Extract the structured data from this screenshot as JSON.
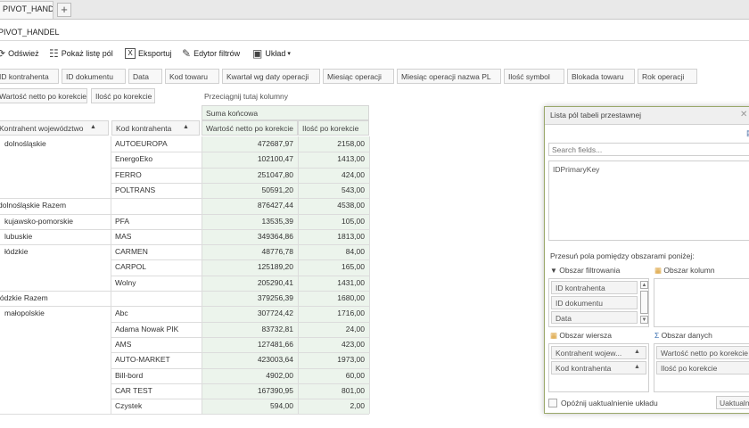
{
  "tab": {
    "label": "PIVOT_HANDEL",
    "add": "+"
  },
  "document_title": "PIVOT_HANDEL",
  "toolbar": {
    "refresh": "Odśwież",
    "show_field_list": "Pokaż listę pól",
    "export": "Eksportuj",
    "filter_editor": "Edytor filtrów",
    "layout": "Układ"
  },
  "filter_fields": [
    "ID kontrahenta",
    "ID dokumentu",
    "Data",
    "Kod towaru",
    "Kwartał wg daty operacji",
    "Miesiąc operacji",
    "Miesiąc operacji nazwa PL",
    "Ilość symbol",
    "Blokada towaru",
    "Rok operacji"
  ],
  "data_fields": [
    "Wartość netto po korekcie",
    "Ilość po korekcie"
  ],
  "column_drop_hint": "Przeciągnij tutaj kolumny",
  "grand_total_label": "Suma końcowa",
  "row_headers": {
    "voivodeship": "Kontrahent województwo",
    "code": "Kod kontrahenta"
  },
  "value_headers": {
    "net": "Wartość netto po korekcie",
    "qty": "Ilość po korekcie"
  },
  "rows": [
    {
      "group": "dolnośląskie",
      "code": "AUTOEUROPA",
      "net": "472687,97",
      "qty": "2158,00"
    },
    {
      "group": "",
      "code": "EnergoEko",
      "net": "102100,47",
      "qty": "1413,00"
    },
    {
      "group": "",
      "code": "FERRO",
      "net": "251047,80",
      "qty": "424,00"
    },
    {
      "group": "",
      "code": "POLTRANS",
      "net": "50591,20",
      "qty": "543,00"
    },
    {
      "group": "dolnośląskie Razem",
      "code": "",
      "net": "876427,44",
      "qty": "4538,00",
      "total": true
    },
    {
      "group": "kujawsko-pomorskie",
      "code": "PFA",
      "net": "13535,39",
      "qty": "105,00"
    },
    {
      "group": "lubuskie",
      "code": "MAS",
      "net": "349364,86",
      "qty": "1813,00"
    },
    {
      "group": "łódzkie",
      "code": "CARMEN",
      "net": "48776,78",
      "qty": "84,00"
    },
    {
      "group": "",
      "code": "CARPOL",
      "net": "125189,20",
      "qty": "165,00"
    },
    {
      "group": "",
      "code": "Wolny",
      "net": "205290,41",
      "qty": "1431,00"
    },
    {
      "group": "łódzkie Razem",
      "code": "",
      "net": "379256,39",
      "qty": "1680,00",
      "total": true
    },
    {
      "group": "małopolskie",
      "code": "Abc",
      "net": "307724,42",
      "qty": "1716,00"
    },
    {
      "group": "",
      "code": "Adama Nowak PIK",
      "net": "83732,81",
      "qty": "24,00"
    },
    {
      "group": "",
      "code": "AMS",
      "net": "127481,66",
      "qty": "423,00"
    },
    {
      "group": "",
      "code": "AUTO-MARKET",
      "net": "423003,64",
      "qty": "1973,00"
    },
    {
      "group": "",
      "code": "Bill-bord",
      "net": "4902,00",
      "qty": "60,00"
    },
    {
      "group": "",
      "code": "CAR TEST",
      "net": "167390,95",
      "qty": "801,00"
    },
    {
      "group": "",
      "code": "Czystek",
      "net": "594,00",
      "qty": "2,00"
    }
  ],
  "panel": {
    "title": "Lista pól tabeli przestawnej",
    "search_placeholder": "Search fields...",
    "field_list": [
      "IDPrimaryKey"
    ],
    "hint": "Przesuń pola pomiędzy obszarami poniżej:",
    "filter_area": {
      "title": "Obszar filtrowania",
      "items": [
        "ID kontrahenta",
        "ID dokumentu",
        "Data"
      ]
    },
    "column_area": {
      "title": "Obszar kolumn"
    },
    "row_area": {
      "title": "Obszar wiersza",
      "items": [
        "Kontrahent wojew...",
        "Kod kontrahenta"
      ]
    },
    "data_area": {
      "title": "Obszar danych",
      "items": [
        "Wartość netto po korekcie",
        "Ilość po korekcie"
      ]
    },
    "defer_label": "Opóźnij uaktualnienie układu",
    "update_button": "Uaktualnij"
  }
}
